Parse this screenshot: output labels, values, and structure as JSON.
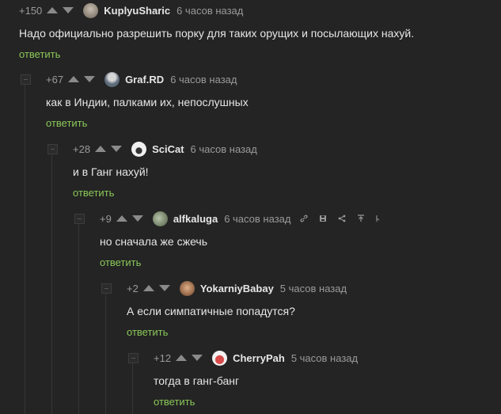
{
  "comments": [
    {
      "score": "+150",
      "author": "KuplyuSharic",
      "time": "6 часов назад",
      "text": "Надо официально разрешить порку для таких орущих и посылающих нахуй.",
      "reply": "ответить",
      "avatar_color": "#9a8f80"
    },
    {
      "score": "+67",
      "author": "Graf.RD",
      "time": "6 часов назад",
      "text": "как в Индии, палками их, непослушных",
      "reply": "ответить",
      "avatar_color": "#7c8794"
    },
    {
      "score": "+28",
      "author": "SciCat",
      "time": "6 часов назад",
      "text": "и в Ганг нахуй!",
      "reply": "ответить",
      "avatar_color": "#e8e8e8"
    },
    {
      "score": "+9",
      "author": "alfkaluga",
      "time": "6 часов назад",
      "text": "но сначала же сжечь",
      "reply": "ответить",
      "avatar_color": "#8a9a7a"
    },
    {
      "score": "+2",
      "author": "YokarniyBabay",
      "time": "5 часов назад",
      "text": "А если симпатичные попадутся?",
      "reply": "ответить",
      "avatar_color": "#b07a50"
    },
    {
      "score": "+12",
      "author": "CherryPah",
      "time": "5 часов назад",
      "text": "тогда в ганг-банг",
      "reply": "ответить",
      "avatar_color": "#c94a4a"
    }
  ],
  "tool_icons": [
    "link-icon",
    "save-icon",
    "share-icon",
    "scroll-up-icon",
    "more-icon"
  ]
}
